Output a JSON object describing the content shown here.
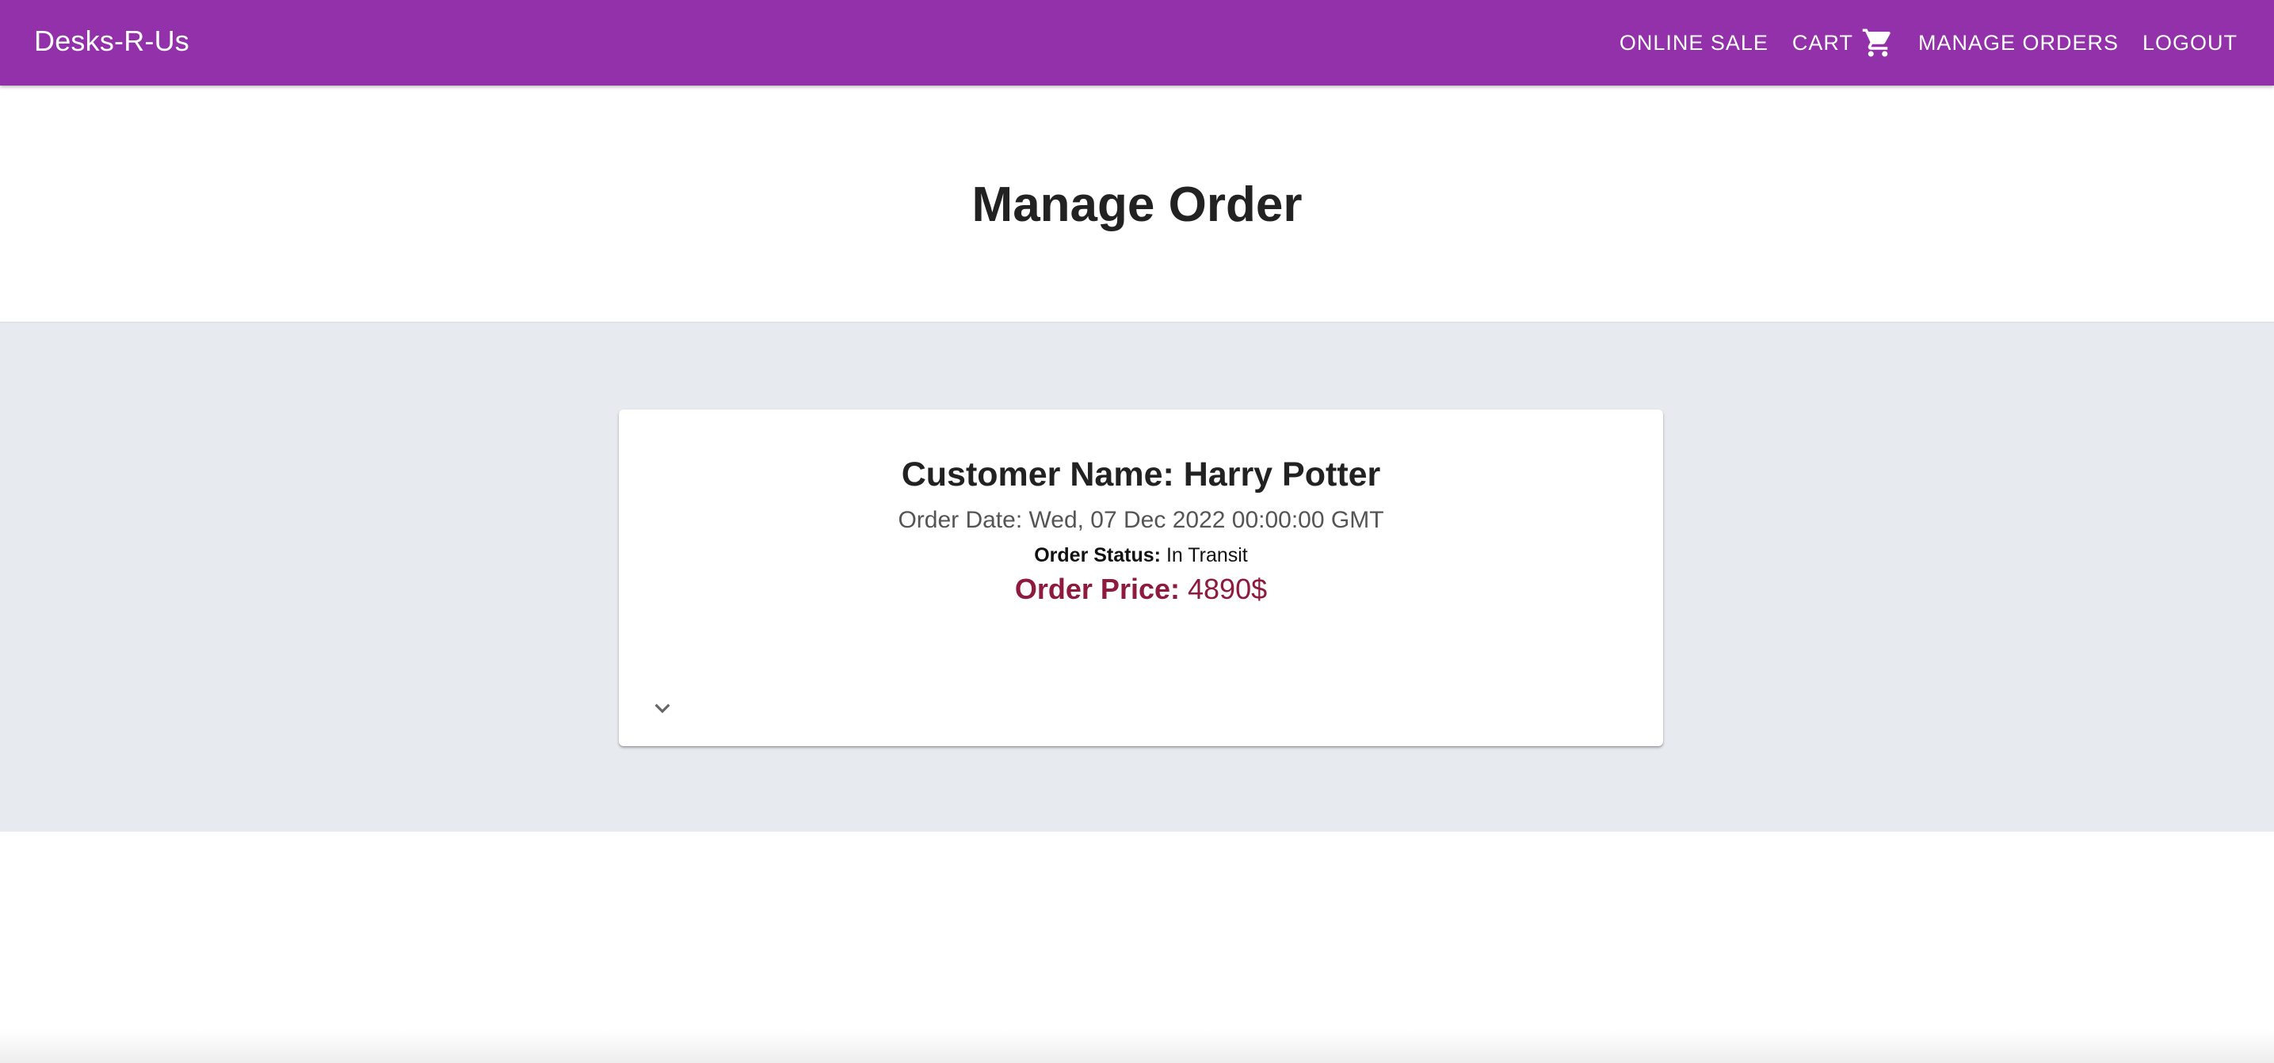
{
  "header": {
    "brand": "Desks-R-Us",
    "nav": {
      "online_sale": "ONLINE SALE",
      "cart": "CART",
      "cart_icon": "shopping-cart-icon",
      "manage_orders": "MANAGE ORDERS",
      "logout": "LOGOUT"
    }
  },
  "page": {
    "title": "Manage Order"
  },
  "order": {
    "customer_name": "Customer Name: Harry Potter",
    "order_date": "Order Date: Wed, 07 Dec 2022 00:00:00 GMT",
    "status_label": "Order Status:",
    "status_value": "In Transit",
    "price_label": "Order Price:",
    "price_value": "4890$",
    "expand_icon": "chevron-down-icon"
  },
  "colors": {
    "appbar": "#9231a9",
    "section_bg": "#e7eaef",
    "price": "#8e1a3d"
  }
}
